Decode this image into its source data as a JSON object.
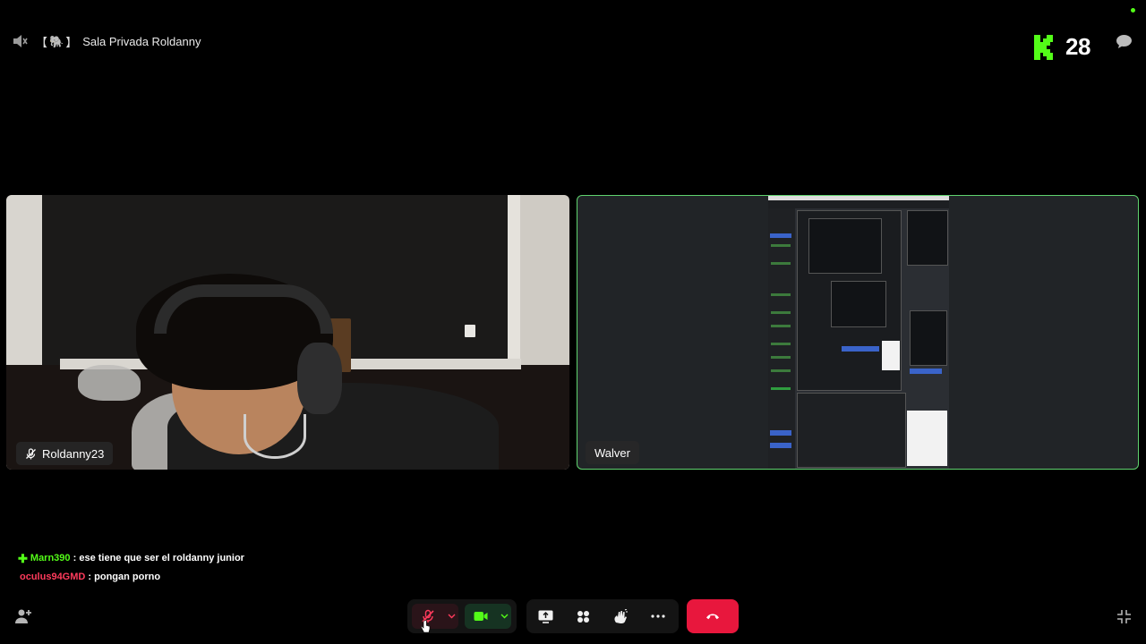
{
  "header": {
    "room_title": "Sala Privada Roldanny",
    "title_open_bracket": "【",
    "title_close_bracket": "】",
    "title_emoji": "🐘",
    "viewer_count": "28"
  },
  "participants": [
    {
      "name": "Roldanny23",
      "muted": true,
      "content": "camera"
    },
    {
      "name": "Walver",
      "muted": false,
      "content": "screen-share",
      "active_speaker": true
    }
  ],
  "chat": {
    "messages": [
      {
        "user": "Marn390",
        "separator": " : ",
        "text": "ese tiene que ser el roldanny junior",
        "badge": "✚"
      },
      {
        "user": "oculus94GMD",
        "separator": " : ",
        "text": "pongan porno"
      }
    ]
  },
  "controls": {
    "mic": {
      "icon": "mic-off-icon",
      "state": "muted"
    },
    "camera": {
      "icon": "video-camera-icon",
      "state": "on"
    },
    "tools": [
      "screen-share-icon",
      "apps-icon",
      "raise-hand-icon",
      "more-icon"
    ],
    "leave": {
      "icon": "hang-up-icon"
    }
  },
  "colors": {
    "accent_green": "#53fc18",
    "leave_red": "#e8173d",
    "active_border": "#5fd36e",
    "chat_user_red": "#ff3b5c"
  }
}
